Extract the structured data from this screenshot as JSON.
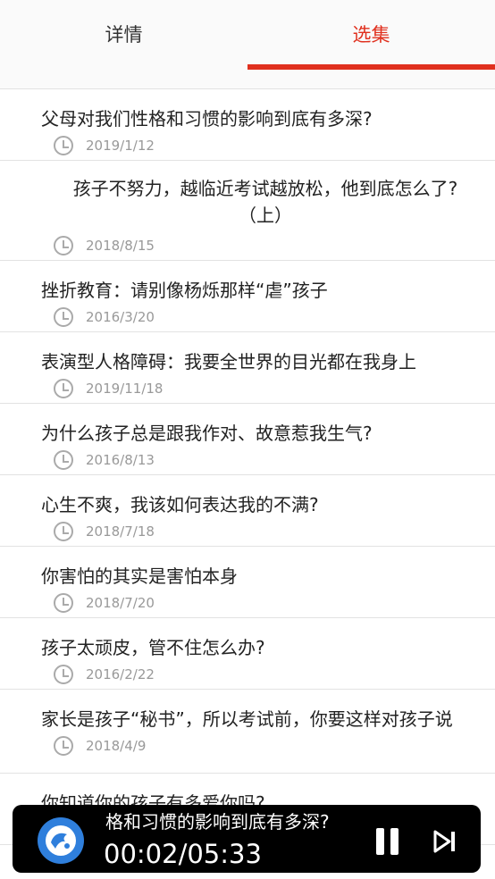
{
  "tabs": [
    {
      "label": "详情",
      "active": false
    },
    {
      "label": "选集",
      "active": true
    }
  ],
  "accent_color": "#e0301e",
  "episodes": [
    {
      "title": "父母对我们性格和习惯的影响到底有多深?",
      "date": "2019/1/12"
    },
    {
      "title": "孩子不努力，越临近考试越放松，他到底怎么了?（上）",
      "date": "2018/8/15"
    },
    {
      "title": "挫折教育：请别像杨烁那样“虐”孩子",
      "date": "2016/3/20"
    },
    {
      "title": "表演型人格障碍：我要全世界的目光都在我身上",
      "date": "2019/11/18"
    },
    {
      "title": "为什么孩子总是跟我作对、故意惹我生气?",
      "date": "2016/8/13"
    },
    {
      "title": "心生不爽，我该如何表达我的不满?",
      "date": "2018/7/18"
    },
    {
      "title": "你害怕的其实是害怕本身",
      "date": "2018/7/20"
    },
    {
      "title": "孩子太顽皮，管不住怎么办?",
      "date": "2016/2/22"
    },
    {
      "title": "家长是孩子“秘书”，所以考试前，你要这样对孩子说",
      "date": "2018/4/9"
    },
    {
      "title": "你知道你的孩子有多爱你吗?",
      "date": ""
    }
  ],
  "player": {
    "title": "格和习惯的影响到底有多深?",
    "time": "00:02/05:33",
    "pause_icon": "pause-icon",
    "next_icon": "skip-next-icon"
  }
}
